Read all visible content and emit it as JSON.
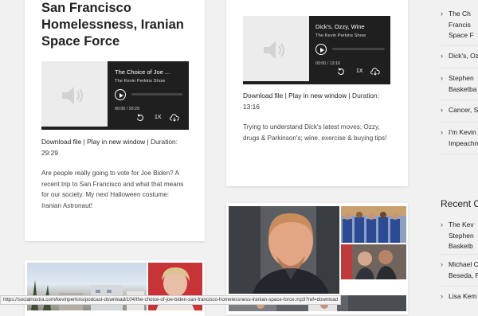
{
  "card1": {
    "title": "San Francisco Homelessness, Iranian Space Force",
    "player": {
      "episode_title": "The Choice of Joe ...",
      "show": "The Kevin Perkins Show",
      "time": "00:00 / 29:29",
      "speed": "1X"
    },
    "meta": {
      "download": "Download file",
      "separator": " | ",
      "play_window": "Play in new window",
      "duration": " | Duration: 29:29"
    },
    "description": "Are people really going to vote for Joe Biden? A recent trip to San Francisco and what that means for our society. My next Halloween costume: Iranian Astronaut!"
  },
  "card2": {
    "player": {
      "episode_title": "Dick's, Ozzy, Wine",
      "show": "The Kevin Perkins Show",
      "time": "00:00 / 13:16",
      "speed": "1X"
    },
    "meta": {
      "download": "Download file",
      "separator": " | ",
      "play_window": "Play in new window",
      "duration": " | Duration: 13:16"
    },
    "description": "Trying to understand Dick's latest moves; Ozzy, drugs & Parkinson's; wine, exercise & buying tips!"
  },
  "sidebar": {
    "top_items": [
      {
        "lines": [
          "The Ch",
          "Francis",
          "Space F"
        ]
      },
      {
        "lines": [
          "Dick's, Oz"
        ]
      },
      {
        "lines": [
          "Stephen",
          "Basketba"
        ]
      },
      {
        "lines": [
          "Cancer, S"
        ]
      },
      {
        "lines": [
          "I'm Kevin",
          "Impeachm"
        ]
      }
    ],
    "recent_heading": "Recent C",
    "recent_items": [
      {
        "lines": [
          "The Kev",
          "Stephen",
          "Basketb"
        ]
      },
      {
        "lines": [
          "Michael C",
          "Beseda, P"
        ]
      },
      {
        "lines": [
          "Lisa Kem"
        ]
      }
    ]
  },
  "status_url": "https://socialnostra.com/kevinperkins/podcast-download/104/the-choice-of-joe-biden-san-francisco-homelessness-iranian-space-force.mp3?ref=download",
  "icons": {
    "speaker": "speaker-icon",
    "play": "play-icon",
    "replay": "replay-icon",
    "download": "cloud-download-icon",
    "chevron": "chevron-right-icon"
  }
}
